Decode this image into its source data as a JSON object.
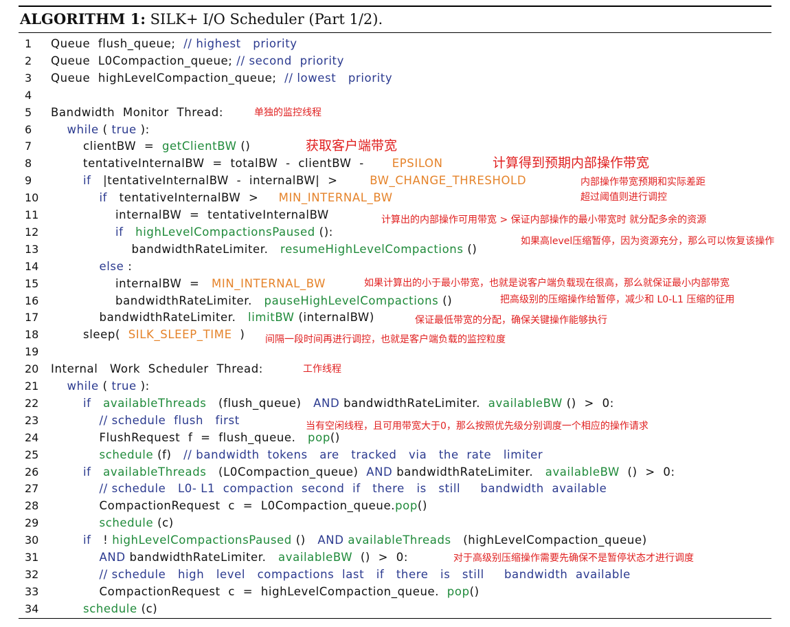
{
  "title": {
    "label": "ALGORITHM 1:",
    "text": "SILK+ I/O Scheduler (Part 1/2)."
  },
  "lines": [
    {
      "n": "1",
      "indent": 0,
      "tokens": [
        [
          "plain",
          "Queue  flush_queue;  "
        ],
        [
          "cm",
          "// highest   priority"
        ]
      ]
    },
    {
      "n": "2",
      "indent": 0,
      "tokens": [
        [
          "plain",
          "Queue  L0Compaction_queue; "
        ],
        [
          "cm",
          "// second  priority"
        ]
      ]
    },
    {
      "n": "3",
      "indent": 0,
      "tokens": [
        [
          "plain",
          "Queue  highLevelCompaction_queue;  "
        ],
        [
          "cm",
          "// lowest   priority"
        ]
      ]
    },
    {
      "n": "4",
      "indent": 0,
      "tokens": []
    },
    {
      "n": "5",
      "indent": 0,
      "tokens": [
        [
          "plain",
          "Bandwidth  Monitor  Thread:"
        ]
      ]
    },
    {
      "n": "6",
      "indent": 1,
      "tokens": [
        [
          "kw",
          "while"
        ],
        [
          "plain",
          " ( "
        ],
        [
          "kw",
          "true"
        ],
        [
          "plain",
          " ):"
        ]
      ]
    },
    {
      "n": "7",
      "indent": 2,
      "tokens": [
        [
          "plain",
          "clientBW  =  "
        ],
        [
          "fn",
          "getClientBW"
        ],
        [
          "plain",
          " ()"
        ]
      ]
    },
    {
      "n": "8",
      "indent": 2,
      "tokens": [
        [
          "plain",
          "tentativeInternalBW  =  totalBW  -  clientBW  -       "
        ],
        [
          "cst",
          "EPSILON"
        ]
      ]
    },
    {
      "n": "9",
      "indent": 2,
      "tokens": [
        [
          "kw",
          "if"
        ],
        [
          "plain",
          "   |tentativeInternalBW  -  internalBW|  >        "
        ],
        [
          "cst",
          "BW_CHANGE_THRESHOLD"
        ]
      ]
    },
    {
      "n": "10",
      "indent": 3,
      "tokens": [
        [
          "kw",
          "if"
        ],
        [
          "plain",
          "   tentativeInternalBW  >     "
        ],
        [
          "cst",
          "MIN_INTERNAL_BW"
        ]
      ]
    },
    {
      "n": "11",
      "indent": 4,
      "tokens": [
        [
          "plain",
          "internalBW  =  tentativeInternalBW"
        ]
      ]
    },
    {
      "n": "12",
      "indent": 4,
      "tokens": [
        [
          "kw",
          "if"
        ],
        [
          "plain",
          "   "
        ],
        [
          "fn",
          "highLevelCompactionsPaused"
        ],
        [
          "plain",
          " ():"
        ]
      ]
    },
    {
      "n": "13",
      "indent": 5,
      "tokens": [
        [
          "plain",
          "bandwidthRateLimiter.   "
        ],
        [
          "fn",
          "resumeHighLevelCompactions"
        ],
        [
          "plain",
          " ()"
        ]
      ]
    },
    {
      "n": "14",
      "indent": 3,
      "tokens": [
        [
          "kw",
          "else"
        ],
        [
          "plain",
          " :"
        ]
      ]
    },
    {
      "n": "15",
      "indent": 4,
      "tokens": [
        [
          "plain",
          "internalBW  =   "
        ],
        [
          "cst",
          "MIN_INTERNAL_BW"
        ]
      ]
    },
    {
      "n": "16",
      "indent": 4,
      "tokens": [
        [
          "plain",
          "bandwidthRateLimiter.   "
        ],
        [
          "fn",
          "pauseHighLevelCompactions"
        ],
        [
          "plain",
          " ()"
        ]
      ]
    },
    {
      "n": "17",
      "indent": 3,
      "tokens": [
        [
          "plain",
          "bandwidthRateLimiter.   "
        ],
        [
          "fn",
          "limitBW"
        ],
        [
          "plain",
          " (internalBW)"
        ]
      ]
    },
    {
      "n": "18",
      "indent": 2,
      "tokens": [
        [
          "plain",
          "sleep(  "
        ],
        [
          "cst",
          "SILK_SLEEP_TIME"
        ],
        [
          "plain",
          "  )"
        ]
      ]
    },
    {
      "n": "19",
      "indent": 0,
      "tokens": []
    },
    {
      "n": "20",
      "indent": 0,
      "tokens": [
        [
          "plain",
          "Internal   Work  Scheduler  Thread:"
        ]
      ]
    },
    {
      "n": "21",
      "indent": 1,
      "tokens": [
        [
          "kw",
          "while"
        ],
        [
          "plain",
          " ( "
        ],
        [
          "kw",
          "true"
        ],
        [
          "plain",
          " ):"
        ]
      ]
    },
    {
      "n": "22",
      "indent": 2,
      "tokens": [
        [
          "kw",
          "if"
        ],
        [
          "plain",
          "   "
        ],
        [
          "fn",
          "availableThreads"
        ],
        [
          "plain",
          "   (flush_queue)   "
        ],
        [
          "kw",
          "AND"
        ],
        [
          "plain",
          " bandwidthRateLimiter.  "
        ],
        [
          "fn",
          "availableBW"
        ],
        [
          "plain",
          " ()  >  0:"
        ]
      ]
    },
    {
      "n": "23",
      "indent": 3,
      "tokens": [
        [
          "cm",
          "// schedule  flush   first"
        ]
      ]
    },
    {
      "n": "24",
      "indent": 3,
      "tokens": [
        [
          "plain",
          "FlushRequest  f  =  flush_queue.   "
        ],
        [
          "fn",
          "pop"
        ],
        [
          "plain",
          "()"
        ]
      ]
    },
    {
      "n": "25",
      "indent": 3,
      "tokens": [
        [
          "fn",
          "schedule"
        ],
        [
          "plain",
          " (f)   "
        ],
        [
          "cm",
          "// bandwidth  tokens   are   tracked   via   the  rate   limiter"
        ]
      ]
    },
    {
      "n": "26",
      "indent": 2,
      "tokens": [
        [
          "kw",
          "if"
        ],
        [
          "plain",
          "   "
        ],
        [
          "fn",
          "availableThreads"
        ],
        [
          "plain",
          "   (L0Compaction_queue)  "
        ],
        [
          "kw",
          "AND"
        ],
        [
          "plain",
          " bandwidthRateLimiter.   "
        ],
        [
          "fn",
          "availableBW"
        ],
        [
          "plain",
          "  ()  >  0:"
        ]
      ]
    },
    {
      "n": "27",
      "indent": 3,
      "tokens": [
        [
          "cm",
          "// schedule   L0- L1  compaction  second  if   there   is   still     bandwidth  available"
        ]
      ]
    },
    {
      "n": "28",
      "indent": 3,
      "tokens": [
        [
          "plain",
          "CompactionRequest  c  =  L0Compaction_queue."
        ],
        [
          "fn",
          "pop"
        ],
        [
          "plain",
          "()"
        ]
      ]
    },
    {
      "n": "29",
      "indent": 3,
      "tokens": [
        [
          "fn",
          "schedule"
        ],
        [
          "plain",
          " (c)"
        ]
      ]
    },
    {
      "n": "30",
      "indent": 2,
      "tokens": [
        [
          "kw",
          "if"
        ],
        [
          "plain",
          "   ! "
        ],
        [
          "fn",
          "highLevelCompactionsPaused"
        ],
        [
          "plain",
          " ()   "
        ],
        [
          "kw",
          "AND"
        ],
        [
          "plain",
          " "
        ],
        [
          "fn",
          "availableThreads"
        ],
        [
          "plain",
          "   (highLevelCompaction_queue)"
        ]
      ]
    },
    {
      "n": "31",
      "indent": 3,
      "tokens": [
        [
          "kw",
          "AND"
        ],
        [
          "plain",
          " bandwidthRateLimiter.   "
        ],
        [
          "fn",
          "availableBW"
        ],
        [
          "plain",
          "  ()  >  0:"
        ]
      ]
    },
    {
      "n": "32",
      "indent": 3,
      "tokens": [
        [
          "cm",
          "// schedule   high   level   compactions  last   if   there   is   still     bandwidth  available"
        ]
      ]
    },
    {
      "n": "33",
      "indent": 3,
      "tokens": [
        [
          "plain",
          "CompactionRequest  c  =  highLevelCompaction_queue.  "
        ],
        [
          "fn",
          "pop"
        ],
        [
          "plain",
          "()"
        ]
      ]
    },
    {
      "n": "34",
      "indent": 2,
      "tokens": [
        [
          "fn",
          "schedule"
        ],
        [
          "plain",
          " (c)"
        ]
      ]
    }
  ],
  "annotations": {
    "a5": "单独的监控线程",
    "a7": "获取客户端带宽",
    "a8": "计算得到预期内部操作带宽",
    "a9": "内部操作带宽预期和实际差距",
    "a10": "超过阈值则进行调控",
    "a11": "计算出的内部操作可用带宽 > 保证内部操作的最小带宽时  就分配多余的资源",
    "a13": "如果高level压缩暂停，因为资源充分，那么可以恢复该操作",
    "a15": "如果计算出的小于最小带宽，也就是说客户端负载现在很高，那么就保证最小内部带宽",
    "a16": "把高级别的压缩操作给暂停，减少和 L0-L1 压缩的征用",
    "a17": "保证最低带宽的分配，确保关键操作能够执行",
    "a18": "间隔一段时间再进行调控，也就是客户端负载的监控粒度",
    "a20": "工作线程",
    "a23": "当有空闲线程，且可用带宽大于0，那么按照优先级分别调度一个相应的操作请求",
    "a31": "对于高级别压缩操作需要先确保不是暂停状态才进行调度"
  }
}
